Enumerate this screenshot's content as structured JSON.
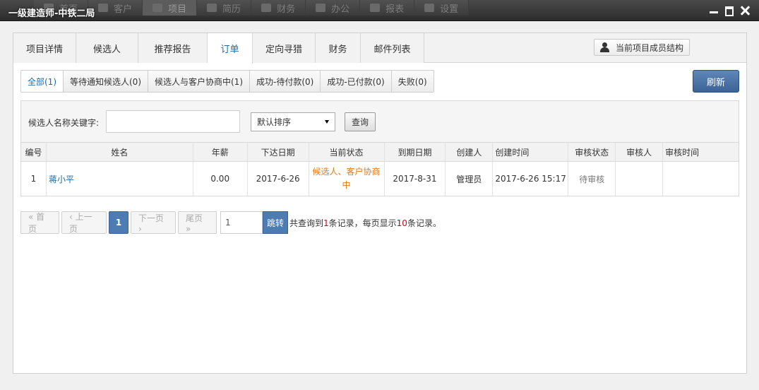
{
  "app": {
    "title": "一级建造师-中铁二局"
  },
  "topnav": [
    {
      "label": "首页",
      "icon": "home-icon"
    },
    {
      "label": "客户",
      "icon": "grid-icon"
    },
    {
      "label": "项目",
      "icon": "folder-icon"
    },
    {
      "label": "简历",
      "icon": "users-icon"
    },
    {
      "label": "财务",
      "icon": "calculator-icon"
    },
    {
      "label": "办公",
      "icon": "printer-icon"
    },
    {
      "label": "报表",
      "icon": "pie-chart-icon"
    },
    {
      "label": "设置",
      "icon": "chat-icon"
    }
  ],
  "tabs": [
    "项目详情",
    "候选人",
    "推荐报告",
    "订单",
    "定向寻猎",
    "财务",
    "邮件列表"
  ],
  "members_button": "当前项目成员结构",
  "filters": [
    "全部(1)",
    "等待通知候选人(0)",
    "候选人与客户协商中(1)",
    "成功-待付款(0)",
    "成功-已付款(0)",
    "失败(0)"
  ],
  "refresh_label": "刷新",
  "search": {
    "label": "候选人名称关键字:",
    "value": "",
    "sort_selected": "默认排序",
    "query_label": "查询"
  },
  "table": {
    "headers": [
      "编号",
      "姓名",
      "年薪",
      "下达日期",
      "当前状态",
      "到期日期",
      "创建人",
      "创建时间",
      "审核状态",
      "审核人",
      "审核时间"
    ],
    "rows": [
      {
        "id": "1",
        "name": "蒋小平",
        "salary": "0.00",
        "issue_date": "2017-6-26",
        "status": "候选人、客户协商中",
        "due_date": "2017-8-31",
        "creator": "管理员",
        "created_time": "2017-6-26 15:17",
        "audit_status": "待审核",
        "auditor": "",
        "audit_time": ""
      }
    ]
  },
  "pager": {
    "first": "« 首页",
    "prev": "‹ 上一页",
    "current": "1",
    "next": "下一页 ›",
    "last": "尾页 »",
    "jump_value": "1",
    "jump_label": "跳转",
    "info_prefix": "共查询到",
    "total": "1",
    "info_mid": "条记录，每页显示",
    "per_page": "10",
    "info_suffix": "条记录。"
  }
}
